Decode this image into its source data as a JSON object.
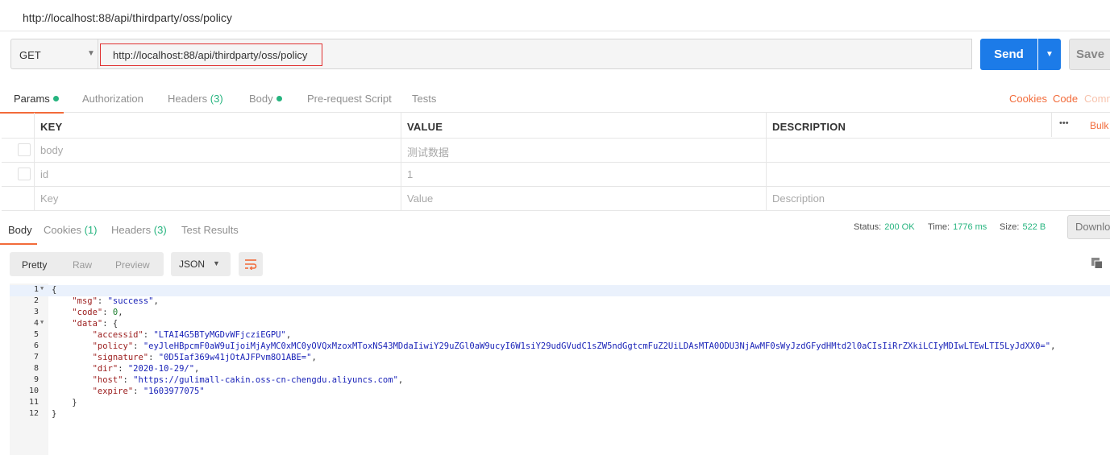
{
  "window": {
    "tab_title": "http://localhost:88/api/thirdparty/oss/policy"
  },
  "request": {
    "method": "GET",
    "url": "http://localhost:88/api/thirdparty/oss/policy",
    "send_label": "Send",
    "save_label": "Save"
  },
  "request_tabs": {
    "params": "Params",
    "authorization": "Authorization",
    "headers": "Headers",
    "headers_count": "(3)",
    "body": "Body",
    "pre_request": "Pre-request Script",
    "tests": "Tests",
    "cookies_link": "Cookies",
    "code_link": "Code",
    "comments_link": "Comm"
  },
  "params_table": {
    "headers": {
      "key": "KEY",
      "value": "VALUE",
      "description": "DESCRIPTION",
      "more": "•••",
      "bulk": "Bulk"
    },
    "rows": [
      {
        "key": "body",
        "value": "测试数据",
        "description": ""
      },
      {
        "key": "id",
        "value": "1",
        "description": ""
      }
    ],
    "placeholder": {
      "key": "Key",
      "value": "Value",
      "description": "Description"
    }
  },
  "response_tabs": {
    "body": "Body",
    "cookies": "Cookies",
    "cookies_count": "(1)",
    "headers": "Headers",
    "headers_count": "(3)",
    "test_results": "Test Results"
  },
  "response_status": {
    "status_label": "Status:",
    "status_value": "200 OK",
    "time_label": "Time:",
    "time_value": "1776 ms",
    "size_label": "Size:",
    "size_value": "522 B",
    "download_label": "Downlo"
  },
  "viewer": {
    "pretty": "Pretty",
    "raw": "Raw",
    "preview": "Preview",
    "format": "JSON"
  },
  "response_body": {
    "msg": "success",
    "code": "0",
    "data": {
      "accessid": "LTAI4G5BTyMGDvWFjcziEGPU",
      "policy": "eyJleHBpcmF0aW9uIjoiMjAyMC0xMC0yOVQxMzoxMToxNS43MDdaIiwiY29uZGl0aW9ucyI6W1siY29udGVudC1sZW5ndGgtcmFuZ2UiLDAsMTA0ODU3NjAwMF0sWyJzdGFydHMtd2l0aCIsIiRrZXkiLCIyMDIwLTEwLTI5LyJdXX0=",
      "signature": "0D5Iaf369w41jOtAJFPvm8O1ABE=",
      "dir": "2020-10-29/",
      "host": "https://gulimall-cakin.oss-cn-chengdu.aliyuncs.com",
      "expire": "1603977075"
    }
  },
  "line_numbers": [
    "1",
    "2",
    "3",
    "4",
    "5",
    "6",
    "7",
    "8",
    "9",
    "10",
    "11",
    "12"
  ],
  "colors": {
    "accent": "#f26b3a",
    "send": "#1c7be8",
    "success": "#26b47f"
  }
}
